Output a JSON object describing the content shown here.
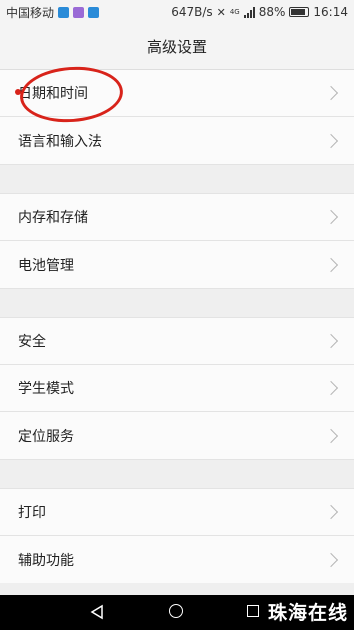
{
  "status_bar": {
    "carrier": "中国移动",
    "net_speed": "647B/s",
    "network_type": "4G",
    "battery": "88%",
    "battery_level": 0.88,
    "time": "16:14",
    "app_icon_colors": [
      "#2a8bd8",
      "#9a6ad6",
      "#2a8bd8"
    ]
  },
  "header": {
    "title": "高级设置"
  },
  "groups": [
    {
      "items": [
        {
          "label": "日期和时间"
        },
        {
          "label": "语言和输入法"
        }
      ]
    },
    {
      "items": [
        {
          "label": "内存和存储"
        },
        {
          "label": "电池管理"
        }
      ]
    },
    {
      "items": [
        {
          "label": "安全"
        },
        {
          "label": "学生模式"
        },
        {
          "label": "定位服务"
        }
      ]
    },
    {
      "items": [
        {
          "label": "打印"
        },
        {
          "label": "辅助功能"
        }
      ]
    }
  ],
  "annotation": {
    "color": "#d8231a"
  },
  "watermark": "珠海在线"
}
